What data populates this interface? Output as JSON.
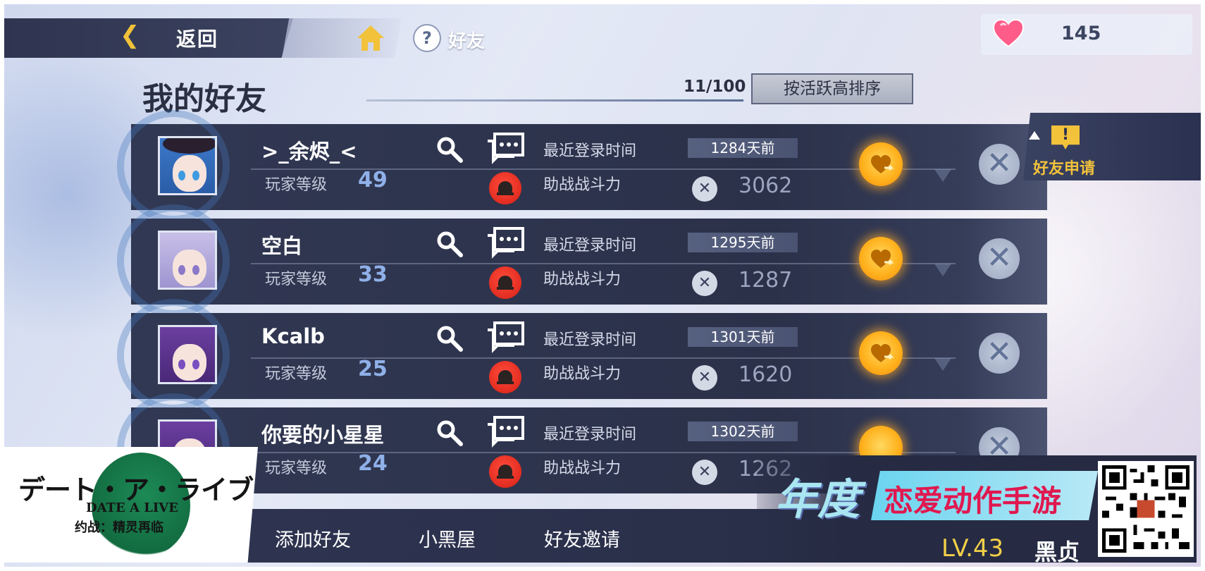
{
  "header": {
    "back_icon": "back-arrow-icon",
    "back_label": "返回",
    "help_icon": "?",
    "help_label": "好友",
    "currency_icon": "heart-icon",
    "currency_value": "145"
  },
  "title": "我的好友",
  "friend_count": "11/100",
  "sort_button": "按活跃高排序",
  "labels": {
    "level": "玩家等级",
    "last_login": "最近登录时间",
    "support_power": "助战战斗力"
  },
  "friends": [
    {
      "name": ">_余烬_<",
      "level": "49",
      "last_login": "1284天前",
      "power": "3062"
    },
    {
      "name": "空白",
      "level": "33",
      "last_login": "1295天前",
      "power": "1287"
    },
    {
      "name": "Kcalb",
      "level": "25",
      "last_login": "1301天前",
      "power": "1620"
    },
    {
      "name": "你要的小星星",
      "level": "24",
      "last_login": "1302天前",
      "power": "1262"
    }
  ],
  "friend_requests": {
    "badge": "!",
    "label": "好友申请"
  },
  "bottom_tabs": [
    "添加好友",
    "小黑屋",
    "好友邀请"
  ],
  "overlay": {
    "logo_jp": "デート・ア・ライブ",
    "logo_en": "DATE A LIVE",
    "logo_cn": "约战：精灵再临",
    "promo_year": "年度",
    "promo_text": "恋爱动作手游",
    "player_level": "LV.43",
    "player_name": "黑贞"
  },
  "colors": {
    "accent_gold": "#f2c23a",
    "row_bg": "#2b3149",
    "block_red": "#d51f16",
    "gift_orange": "#ffb21e"
  }
}
